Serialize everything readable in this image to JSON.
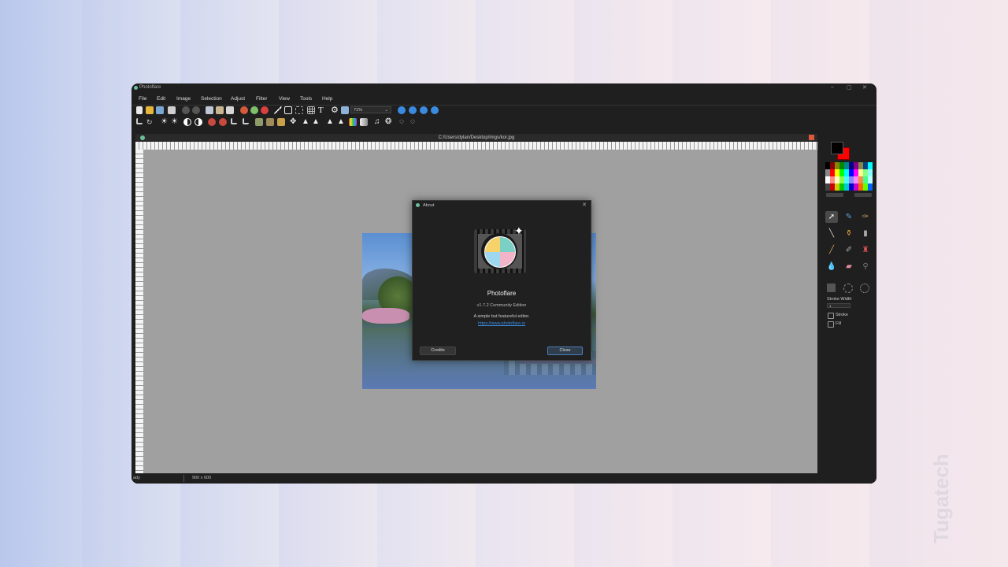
{
  "app": {
    "title": "Photoflare",
    "menus": [
      "File",
      "Edit",
      "Image",
      "Selection",
      "Adjust",
      "Filter",
      "View",
      "Tools",
      "Help"
    ],
    "zoom": "71%",
    "document_path": "C:/Users/dylan/Desktop/imgs/kor.jpg",
    "status_left": "ady",
    "status_size": "900 x 600"
  },
  "window_controls": {
    "minimize": "–",
    "maximize": "▢",
    "close": "✕"
  },
  "about": {
    "title": "About",
    "app_name": "Photoflare",
    "version": "v1.7.2 Community Edition",
    "tagline": "A simple but featureful editor.",
    "url": "https://www.photoflare.io",
    "credits_label": "Credits",
    "close_label": "Close"
  },
  "tool_options": {
    "stroke_width_label": "Stroke Width",
    "stroke_width_value": "1",
    "stroke_label": "Stroke",
    "fill_label": "Fill"
  },
  "colors": {
    "primary": "#000000",
    "secondary": "#ff0000",
    "accent_link": "#3a8be0"
  },
  "watermark": "Tugatech"
}
